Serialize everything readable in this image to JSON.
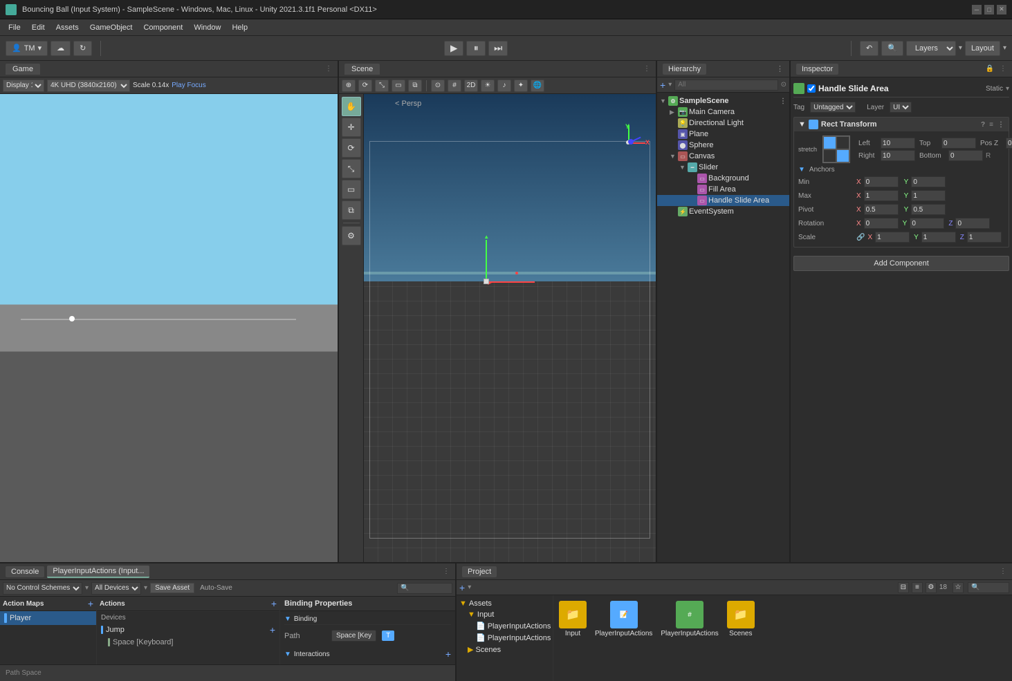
{
  "titleBar": {
    "title": "Bouncing Ball (Input System) - SampleScene - Windows, Mac, Linux - Unity 2021.3.1f1 Personal <DX11>"
  },
  "menuBar": {
    "items": [
      "File",
      "Edit",
      "Assets",
      "GameObject",
      "Component",
      "Window",
      "Help"
    ]
  },
  "toolbar": {
    "account": "TM",
    "layersLabel": "Layers",
    "layoutLabel": "Layout",
    "playBtn": "▶",
    "pauseBtn": "⏸",
    "stepBtn": "⏭"
  },
  "gameView": {
    "tabLabel": "Game",
    "displayLabel": "Display 1",
    "resolution": "4K UHD (3840x2160)",
    "scale": "Scale   0.14x",
    "playFocus": "Play Focus"
  },
  "sceneView": {
    "tabLabel": "Scene",
    "perspLabel": "< Persp"
  },
  "hierarchy": {
    "tabLabel": "Hierarchy",
    "searchPlaceholder": "All",
    "sceneName": "SampleScene",
    "items": [
      {
        "name": "SampleScene",
        "depth": 0,
        "type": "scene",
        "expanded": true
      },
      {
        "name": "Main Camera",
        "depth": 1,
        "type": "camera",
        "expanded": false
      },
      {
        "name": "Directional Light",
        "depth": 1,
        "type": "light",
        "expanded": false
      },
      {
        "name": "Plane",
        "depth": 1,
        "type": "mesh",
        "expanded": false
      },
      {
        "name": "Sphere",
        "depth": 1,
        "type": "mesh",
        "expanded": false
      },
      {
        "name": "Canvas",
        "depth": 1,
        "type": "canvas",
        "expanded": true
      },
      {
        "name": "Slider",
        "depth": 2,
        "type": "slider",
        "expanded": true
      },
      {
        "name": "Background",
        "depth": 3,
        "type": "ui",
        "expanded": false
      },
      {
        "name": "Fill Area",
        "depth": 3,
        "type": "ui",
        "expanded": false
      },
      {
        "name": "Handle Slide Area",
        "depth": 3,
        "type": "ui",
        "expanded": false,
        "selected": true
      },
      {
        "name": "EventSystem",
        "depth": 1,
        "type": "event",
        "expanded": false
      }
    ]
  },
  "inspector": {
    "tabLabel": "Inspector",
    "componentName": "Handle Slide Area",
    "isActive": true,
    "isStatic": false,
    "tag": "Untagged",
    "layer": "UI",
    "rectTransform": {
      "label": "Rect Transform",
      "stretch": "stretch",
      "left": "10",
      "top": "0",
      "posZ": "0",
      "right": "10",
      "bottom": "0",
      "anchorsLabel": "Anchors",
      "minX": "0",
      "minY": "0",
      "maxX": "1",
      "maxY": "1",
      "pivotX": "0.5",
      "pivotY": "0.5",
      "rotX": "0",
      "rotY": "0",
      "rotZ": "0",
      "scaleX": "1",
      "scaleY": "1",
      "scaleZ": "1"
    },
    "addComponentLabel": "Add Component"
  },
  "bottomLeft": {
    "consoleTabs": [
      "Console",
      "PlayerInputActions (Input..."
    ],
    "activeTab": "PlayerInputActions (Input...",
    "noControlSchemes": "No Control Schemes",
    "allDevices": "All Devices",
    "saveAsset": "Save Asset",
    "autoSave": "Auto-Save",
    "actionMapsHeader": "Action Maps",
    "actionsHeader": "Actions",
    "devicesLabel": "Devices",
    "bindingProps": "Binding Properties",
    "bindingLabel": "Binding",
    "pathLabel": "Path",
    "pathValue": "Space [Key",
    "interactionsLabel": "Interactions",
    "pathSpace": "Path Space",
    "actionMaps": [
      {
        "name": "Player",
        "color": "#5af"
      }
    ],
    "actions": [
      {
        "name": "Jump",
        "color": "#5af",
        "indent": false
      },
      {
        "name": "Space [Keyboard]",
        "color": "#8a8",
        "indent": true
      }
    ]
  },
  "project": {
    "tabLabel": "Project",
    "assets": {
      "root": "Assets",
      "folders": [
        {
          "name": "Input",
          "indent": 1
        },
        {
          "name": "PlayerInputActions",
          "indent": 2
        },
        {
          "name": "PlayerInputActions",
          "indent": 2
        },
        {
          "name": "Scenes",
          "indent": 1
        }
      ]
    }
  },
  "statusBar": {
    "pathSpace": "Path Space"
  }
}
